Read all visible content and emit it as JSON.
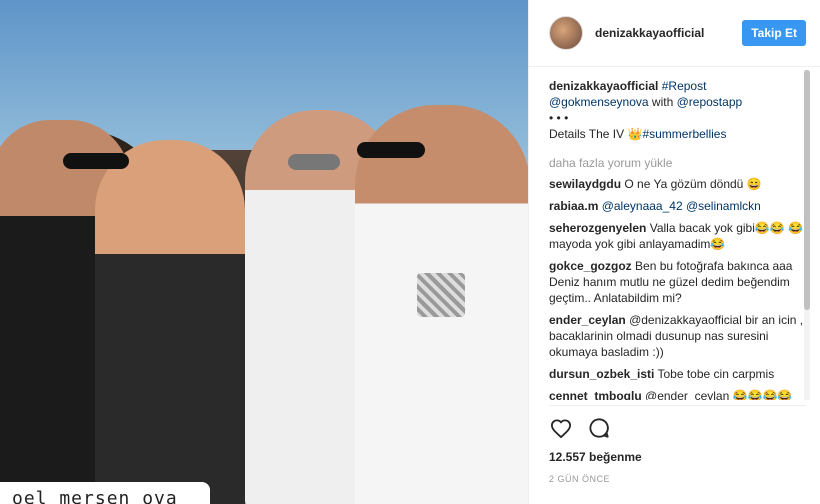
{
  "photo": {
    "caption_overlay": "oel mersen ova"
  },
  "header": {
    "username": "denizakkayaofficial",
    "follow_label": "Takip Et"
  },
  "caption": {
    "username": "denizakkayaofficial",
    "hashtag": "#Repost",
    "mention": "@gokmenseynova",
    "with_text": "with",
    "app_mention": "@repostapp",
    "dots": "• • •",
    "details": "Details The IV",
    "crown": "👑",
    "hashtag2": "#summerbellies"
  },
  "load_more": "daha fazla yorum yükle",
  "comments": [
    {
      "user": "sewilaydgdu",
      "text": "O ne Ya gözüm döndü 😄"
    },
    {
      "user": "rabiaa.m",
      "text": "@aleynaaa_42 @selinamlckn"
    },
    {
      "user": "seherozgenyelen",
      "text": "Valla bacak yok gibi😂😂 😂mayoda yok gibi anlayamadim😂"
    },
    {
      "user": "gokce_gozgoz",
      "text": "Ben bu fotoğrafa bakınca aaa Deniz hanım mutlu ne güzel dedim beğendim geçtim.. Anlatabildim mi?"
    },
    {
      "user": "ender_ceylan",
      "text": "@denizakkayaofficial bir an icin , bacaklarinin olmadi dusunup nas suresini okumaya basladim :))"
    },
    {
      "user": "dursun_ozbek_isti",
      "text": "Tobe tobe cin carpmis"
    },
    {
      "user": "cennet_tmboglu",
      "text": "@ender_ceylan 😂😂😂😂 😂"
    }
  ],
  "likes": "12.557 beğenme",
  "time": "2 GÜN ÖNCE",
  "icons": {
    "like": "heart-icon",
    "comment": "comment-icon"
  }
}
